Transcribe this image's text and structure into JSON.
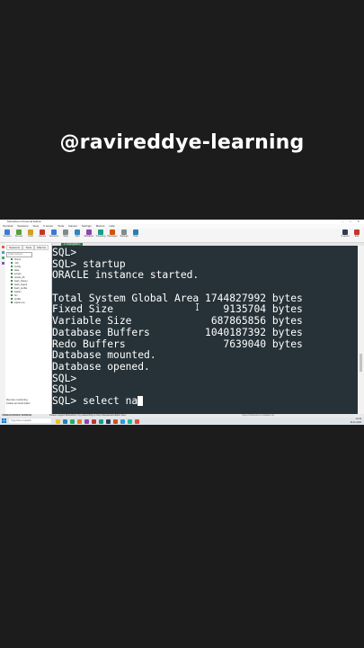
{
  "watermark": "@ravireddye-learning",
  "window": {
    "title": "MobaXterm Personal Edition"
  },
  "menubar": [
    "Terminal",
    "Sessions",
    "View",
    "X server",
    "Tools",
    "Games",
    "Settings",
    "Macros",
    "Help"
  ],
  "toolbar": {
    "buttons": [
      {
        "label": "Session",
        "icon": "session-icon",
        "color": "#3a7bd5"
      },
      {
        "label": "Servers",
        "icon": "servers-icon",
        "color": "#5a9e3f"
      },
      {
        "label": "Tools",
        "icon": "tools-icon",
        "color": "#d1a01f"
      },
      {
        "label": "Games",
        "icon": "games-icon",
        "color": "#c0392b"
      },
      {
        "label": "Sessions",
        "icon": "sessions-icon",
        "color": "#3a7bd5"
      },
      {
        "label": "View",
        "icon": "view-icon",
        "color": "#7f8c8d"
      },
      {
        "label": "Split",
        "icon": "split-icon",
        "color": "#2e86c1"
      },
      {
        "label": "MultiExec",
        "icon": "multiexec-icon",
        "color": "#8e44ad"
      },
      {
        "label": "Tunneling",
        "icon": "tunneling-icon",
        "color": "#16a085"
      },
      {
        "label": "Packages",
        "icon": "packages-icon",
        "color": "#d35400"
      },
      {
        "label": "Settings",
        "icon": "settings-icon",
        "color": "#7f8c8d"
      },
      {
        "label": "Help",
        "icon": "help-icon",
        "color": "#2980b9"
      }
    ],
    "right_buttons": [
      {
        "label": "X server",
        "icon": "xserver-icon",
        "color": "#2c3e50"
      },
      {
        "label": "Exit",
        "icon": "exit-icon",
        "color": "#c0392b"
      }
    ]
  },
  "sidebar": {
    "tabs": [
      "Sessions",
      "Tools",
      "Macros"
    ],
    "search_placeholder": "Quick connect...",
    "tree": [
      "/home",
      ".ssh",
      "config",
      "data",
      "scripts",
      "oracle_db",
      "bash_history",
      "bash_logout",
      "bash_profile",
      "bashrc",
      "bin",
      "profile",
      "sqlnet.ora"
    ],
    "notice_title": "Remote monitoring",
    "notice_sub": "Follow terminal folder"
  },
  "tab": {
    "label": "2. oracle@dbsrv"
  },
  "terminal": {
    "lines": [
      "SQL>",
      "SQL> startup",
      "ORACLE instance started.",
      "",
      "Total System Global Area 1744827992 bytes",
      "Fixed Size                  9135704 bytes",
      "Variable Size             687865856 bytes",
      "Database Buffers         1040187392 bytes",
      "Redo Buffers                7639040 bytes",
      "Database mounted.",
      "Database opened.",
      "SQL>",
      "SQL>"
    ],
    "prompt_line": "SQL> select na"
  },
  "statusbar": {
    "edition": "UNREGISTERED VERSION",
    "message": "Please support MobaXterm by subscribing to the professional edition here:",
    "link": "https://mobaxterm.mobatek.net"
  },
  "taskbar": {
    "search_placeholder": "Type here to search",
    "apps": [
      "#f1c40f",
      "#2980b9",
      "#27ae60",
      "#e67e22",
      "#8e44ad",
      "#c0392b",
      "#16a085",
      "#2c3e50",
      "#d35400",
      "#3498db",
      "#1abc9c",
      "#e74c3c"
    ],
    "time": "10:44",
    "date": "15-11-2023"
  }
}
